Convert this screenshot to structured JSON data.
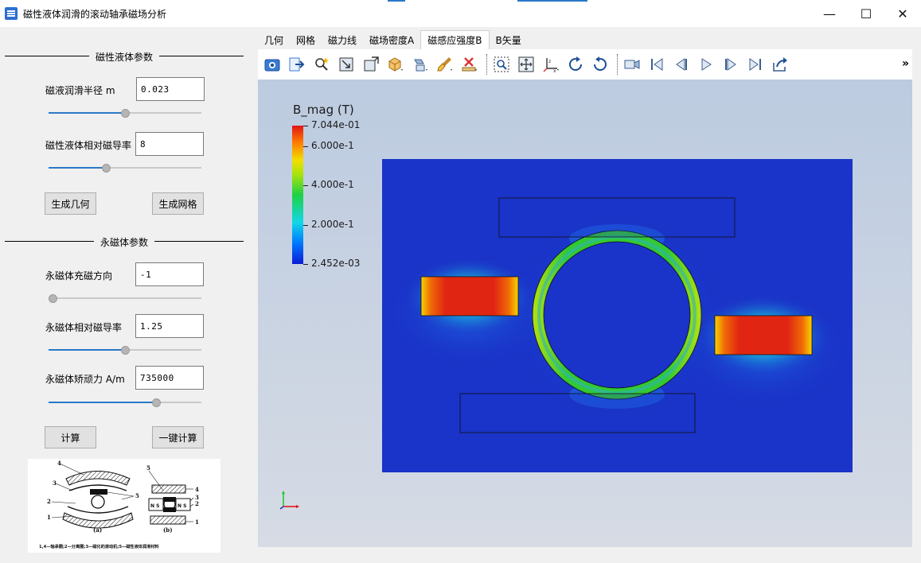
{
  "window": {
    "title": "磁性液体润滑的滚动轴承磁场分析",
    "min": "—",
    "max": "☐",
    "close": "✕"
  },
  "fluid_group": {
    "title": "磁性液体参数",
    "radius_label": "磁液润滑半径 m",
    "radius_value": "0.023",
    "radius_slider": 0.5,
    "perm_label": "磁性液体相对磁导率",
    "perm_value": "8",
    "perm_slider": 0.37,
    "gen_geometry": "生成几何",
    "gen_mesh": "生成网格"
  },
  "magnet_group": {
    "title": "永磁体参数",
    "dir_label": "永磁体充磁方向",
    "dir_value": "-1",
    "dir_slider": 0.0,
    "perm_label": "永磁体相对磁导率",
    "perm_value": "1.25",
    "perm_slider": 0.5,
    "coercive_label": "永磁体矫顽力 A/m",
    "coercive_value": "735000",
    "coercive_slider": 0.72,
    "compute": "计算",
    "one_click": "一键计算"
  },
  "diagram": {
    "labels": [
      "4",
      "3",
      "2",
      "1",
      "5",
      "5",
      "4",
      "3",
      "2",
      "1"
    ],
    "sub_a": "(a)",
    "sub_b": "(b)",
    "magnet_text": "N S",
    "caption": "1,4—轴承圈;2—分离圈;3—磁化的滚动机;5—磁性液体润滑材料"
  },
  "tabs": [
    "几何",
    "网格",
    "磁力线",
    "磁场密度A",
    "磁感应强度B",
    "B矢量"
  ],
  "active_tab": 4,
  "toolbar": {
    "icons": [
      "camera-icon",
      "export-icon",
      "zoom-wand-icon",
      "frame-icon",
      "box-icon",
      "cube-dropdown-icon",
      "light-dropdown-icon",
      "brush-dropdown-icon",
      "delete-ruler-icon",
      "zoom-box-icon",
      "pan-icon",
      "axes-dropdown-icon",
      "rotate-cw-icon",
      "rotate-ccw-icon",
      "video-camera-icon",
      "first-frame-icon",
      "prev-frame-icon",
      "play-icon",
      "next-frame-icon",
      "last-frame-icon",
      "share-icon"
    ],
    "more": "»"
  },
  "colorbar": {
    "title": "B_mag (T)",
    "max_label": "7.044e-01",
    "labels": [
      "6.000e-1",
      "4.000e-1",
      "2.000e-1"
    ],
    "min_label": "2.452e-03",
    "min": 0.002452,
    "max": 0.7044,
    "ticks": [
      0.6,
      0.4,
      0.2
    ]
  },
  "colors": {
    "field_base": "#1a33c8",
    "magnet": "#e21a12",
    "ring": "#4fc32a",
    "accent": "#2a79c8"
  }
}
